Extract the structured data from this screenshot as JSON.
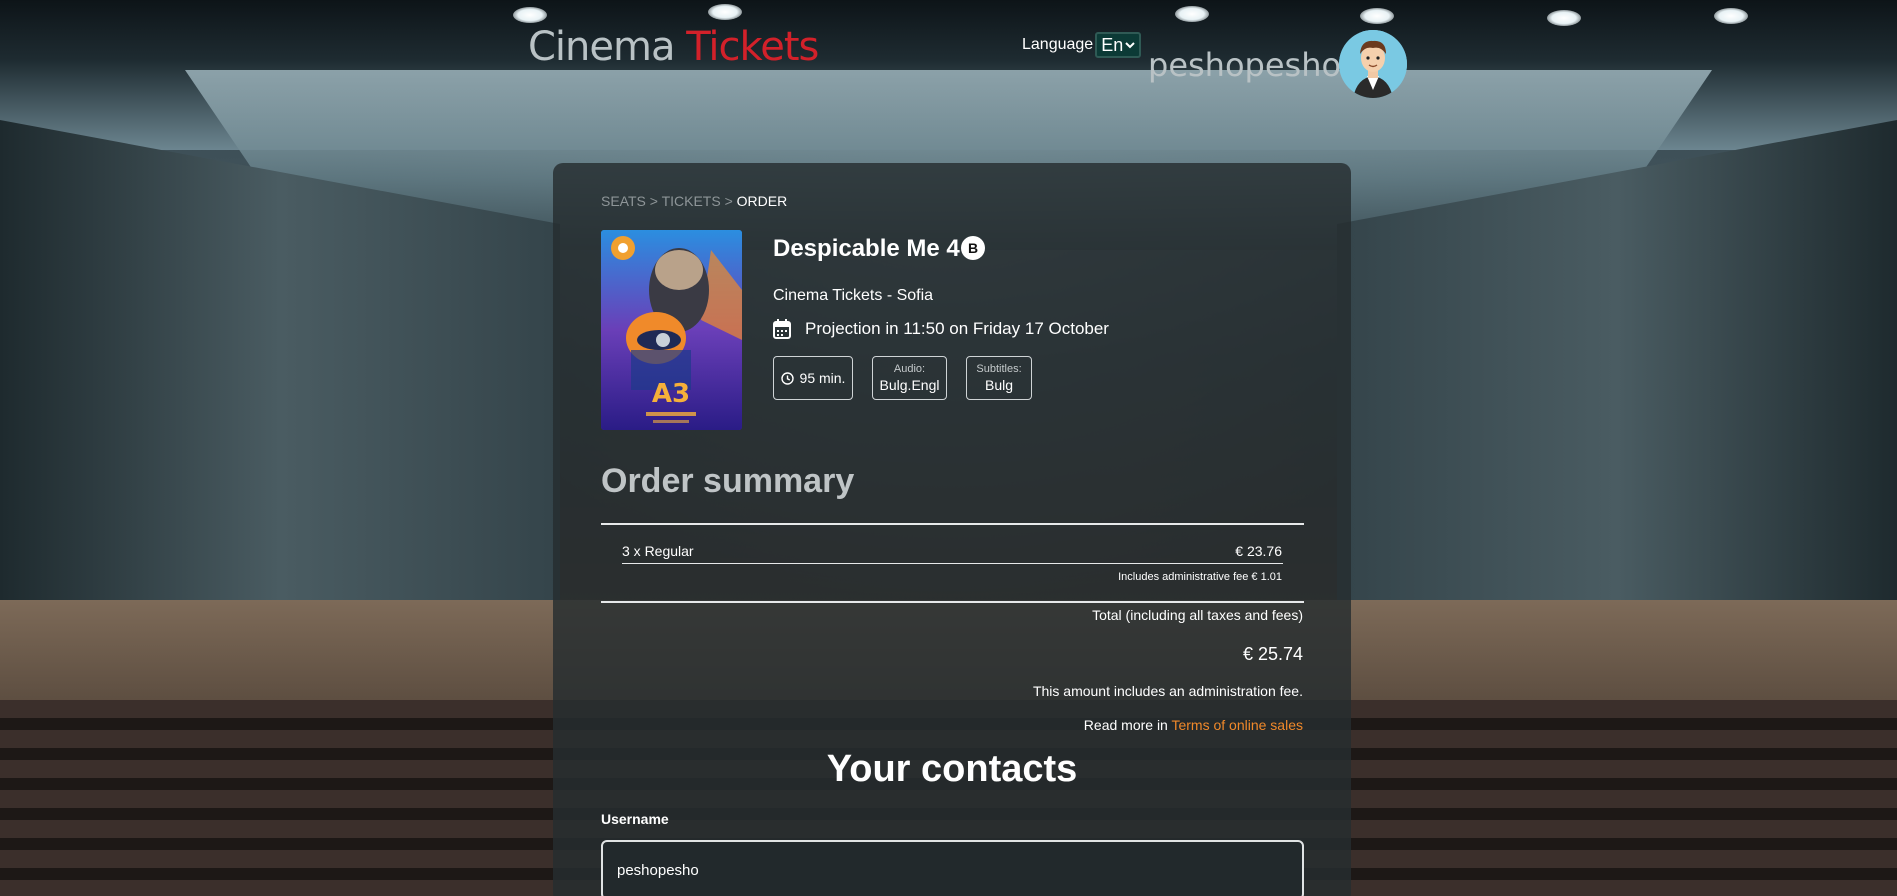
{
  "header": {
    "brand_part1": "Cinema",
    "brand_part2": "Tickets",
    "language_label": "Language",
    "language_value": "En",
    "username": "peshopesho"
  },
  "breadcrumb": {
    "step1": "SEATS",
    "sep1": " > ",
    "step2": "TICKETS",
    "sep2": " > ",
    "step3": "ORDER"
  },
  "movie": {
    "title": "Despicable Me 4",
    "rating": "B",
    "cinema": "Cinema Tickets - Sofia",
    "projection": "Projection in 11:50 on Friday 17 October",
    "duration": "95 min.",
    "audio_label": "Audio:",
    "audio_value": "Bulg.Engl",
    "subtitles_label": "Subtitles:",
    "subtitles_value": "Bulg"
  },
  "order": {
    "title": "Order summary",
    "line_label": "3 x Regular",
    "line_price": "€ 23.76",
    "fee_note": "Includes administrative fee € 1.01",
    "total_label": "Total (including all taxes and fees)",
    "total_value": "€ 25.74",
    "amount_note": "This amount includes an administration fee.",
    "read_more_prefix": "Read more in",
    "terms_link": "Terms of online sales"
  },
  "contacts": {
    "title": "Your contacts",
    "username_label": "Username",
    "username_value": "peshopesho"
  },
  "colors": {
    "brand_red": "#d3212a",
    "link_orange": "#f1892a"
  }
}
